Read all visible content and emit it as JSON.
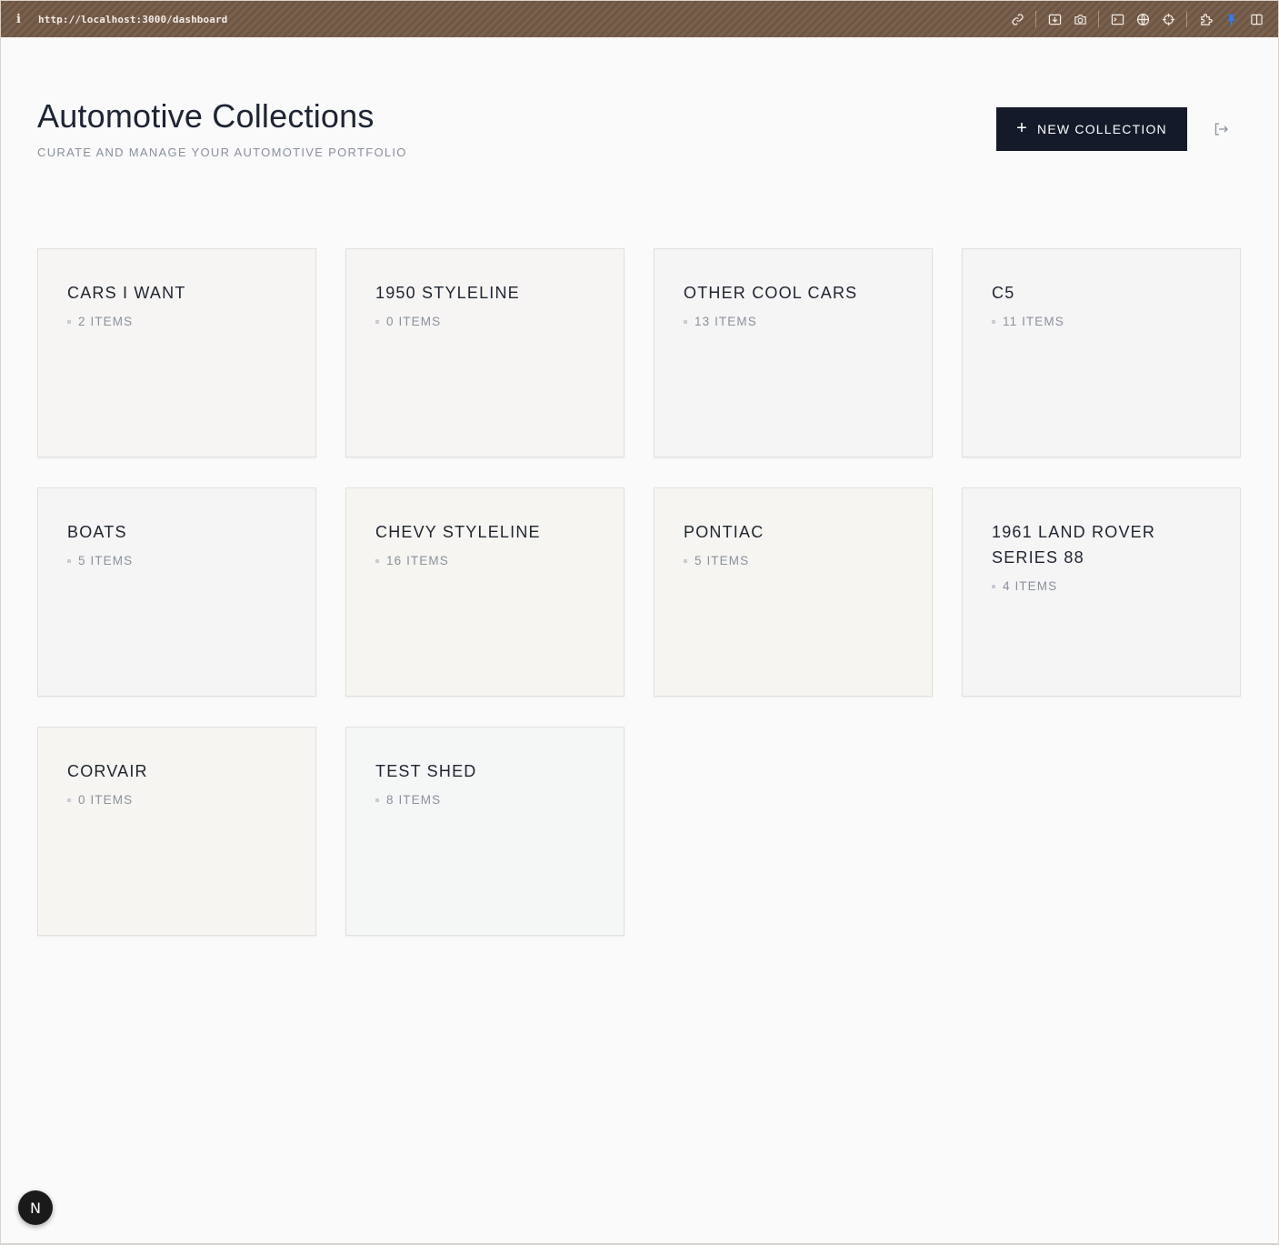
{
  "browser": {
    "url": "http://localhost:3000/dashboard",
    "icons": [
      "link-icon",
      "download-icon",
      "camera-icon",
      "terminal-icon",
      "globe-icon",
      "crosshair-icon",
      "extensions-icon",
      "pin-icon",
      "sidebar-icon"
    ]
  },
  "header": {
    "title": "Automotive Collections",
    "subtitle": "CURATE AND MANAGE YOUR AUTOMOTIVE PORTFOLIO",
    "new_button": {
      "icon": "plus-icon",
      "label": "NEW COLLECTION"
    },
    "logout_icon": "logout-icon"
  },
  "collections": [
    {
      "title": "CARS I WANT",
      "count": "2 ITEMS",
      "bg": "#f6f5f3"
    },
    {
      "title": "1950 STYLELINE",
      "count": "0 ITEMS",
      "bg": "#f6f5f3"
    },
    {
      "title": "OTHER COOL CARS",
      "count": "13 ITEMS",
      "bg": "#f5f5f5"
    },
    {
      "title": "C5",
      "count": "11 ITEMS",
      "bg": "#f5f5f5"
    },
    {
      "title": "BOATS",
      "count": "5 ITEMS",
      "bg": "#f5f5f5"
    },
    {
      "title": "CHEVY STYLELINE",
      "count": "16 ITEMS",
      "bg": "#f6f5f1"
    },
    {
      "title": "PONTIAC",
      "count": "5 ITEMS",
      "bg": "#f6f5f2"
    },
    {
      "title": "1961 LAND ROVER SERIES 88",
      "count": "4 ITEMS",
      "bg": "#f5f5f5"
    },
    {
      "title": "CORVAIR",
      "count": "0 ITEMS",
      "bg": "#f6f5f1"
    },
    {
      "title": "TEST SHED",
      "count": "8 ITEMS",
      "bg": "#f5f7f7"
    }
  ],
  "badge": {
    "letter": "N"
  }
}
